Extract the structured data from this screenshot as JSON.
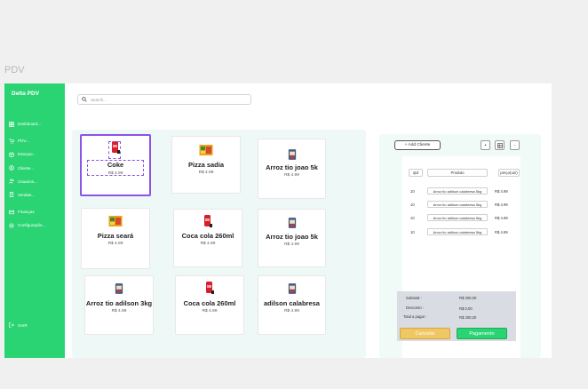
{
  "frame_label": "PDV",
  "sidebar": {
    "brand": "Delta PDV",
    "items": [
      {
        "label": "Dashboard...",
        "icon": "dashboard-icon"
      },
      {
        "label": "PDV...",
        "icon": "cart-icon"
      },
      {
        "label": "Estoque...",
        "icon": "box-icon"
      },
      {
        "label": "Cliente...",
        "icon": "user-icon"
      },
      {
        "label": "Usuarios...",
        "icon": "users-icon"
      },
      {
        "label": "Vendas...",
        "icon": "receipt-icon"
      },
      {
        "label": "Finanças",
        "icon": "finance-icon"
      },
      {
        "label": "Configuração...",
        "icon": "gear-icon"
      }
    ],
    "logout": "SAIR"
  },
  "search": {
    "placeholder": "Search..."
  },
  "products": [
    {
      "name": "Coke",
      "price": "R$ 4.99",
      "icon": "coke-can-icon"
    },
    {
      "name": "Pizza sadia",
      "price": "R$ 4.99",
      "icon": "pizza-box-icon"
    },
    {
      "name": "Arroz tio joao 5k",
      "price": "R$ 4.99",
      "icon": "rice-bag-icon"
    },
    {
      "name": "Pizza seará",
      "price": "R$ 4.99",
      "icon": "pizza-box-icon"
    },
    {
      "name": "Coca cola 260ml",
      "price": "R$ 4.99",
      "icon": "coke-can-icon"
    },
    {
      "name": "Arroz tio joao 5k",
      "price": "R$ 4.99",
      "icon": "rice-bag-icon"
    },
    {
      "name": "Arroz tio adilson 3kg",
      "price": "R$ 4.99",
      "icon": "rice-bag-icon"
    },
    {
      "name": "Coca cola 260ml",
      "price": "R$ 4.99",
      "icon": "coke-can-icon"
    },
    {
      "name": "adilson calabresa",
      "price": "R$ 4.99",
      "icon": "rice-bag-icon"
    }
  ],
  "order": {
    "add_client": "+ Add Cliente",
    "headers": {
      "qty": "qtd",
      "product": "Produto",
      "price": "preço(uni)"
    },
    "rows": [
      {
        "qty": "10",
        "product": "Arroz tio adilson calabresa 5kg",
        "price": "R$ 4.99"
      },
      {
        "qty": "10",
        "product": "Arroz tio adilson calabresa 5kg",
        "price": "R$ 4.99"
      },
      {
        "qty": "10",
        "product": "Arroz tio adilson calabresa 5kg",
        "price": "R$ 4.99"
      },
      {
        "qty": "10",
        "product": "Arroz tio adilson calabresa 5kg",
        "price": "R$ 4.99"
      }
    ],
    "subtotal_label": "Subtotal :",
    "subtotal_value": "R$ 200,00",
    "discount_label": "Desconto :",
    "discount_value": "R$ 0,00",
    "total_label": "Total a pagar :",
    "total_value": "R$ 200,00",
    "cancel": "Cancelar",
    "pay": "Pagamento"
  }
}
